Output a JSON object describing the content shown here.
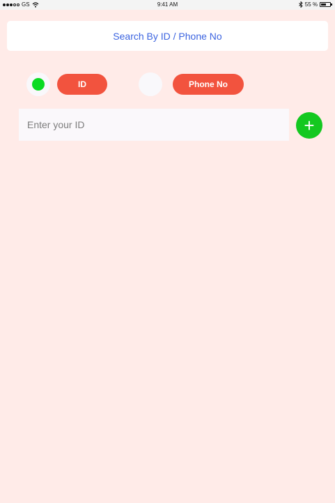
{
  "status_bar": {
    "carrier": "GS",
    "time": "9:41 AM",
    "battery": "55 %",
    "battery_level": 0.55
  },
  "header": {
    "title": "Search By ID / Phone No"
  },
  "search_type": {
    "options": [
      {
        "label": "ID",
        "selected": true
      },
      {
        "label": "Phone No",
        "selected": false
      }
    ]
  },
  "input": {
    "placeholder": "Enter your ID",
    "value": ""
  },
  "add_button": {
    "icon": "plus-icon",
    "glyph": "+"
  },
  "colors": {
    "background": "#ffebe8",
    "accent_red": "#f2533e",
    "selected_green": "#0adb22",
    "add_green": "#14c820",
    "title_blue": "#3c64e0"
  }
}
